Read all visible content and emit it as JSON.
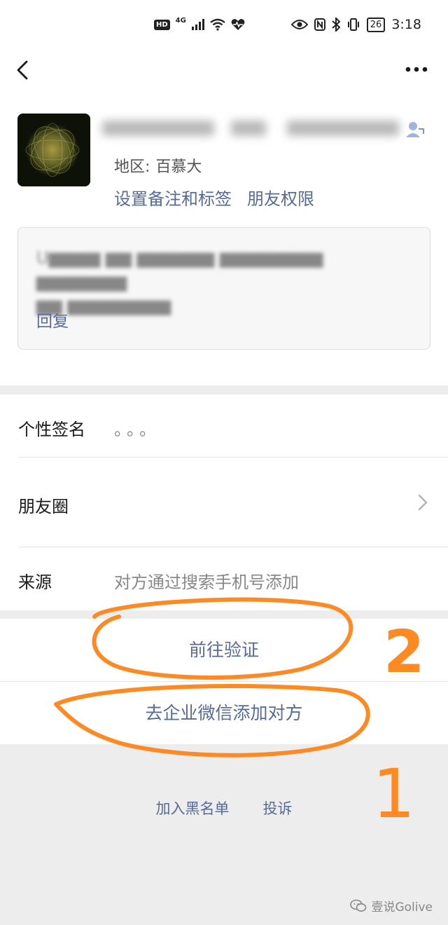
{
  "status_bar": {
    "hd": "HD",
    "network": "4G",
    "battery": "26",
    "time": "3:18"
  },
  "profile": {
    "region_label": "地区:",
    "region_value": "百慕大",
    "set_remark_label": "设置备注和标签",
    "friend_permission_label": "朋友权限"
  },
  "greeting": {
    "reply_label": "回复"
  },
  "info_rows": {
    "signature_label": "个性签名",
    "signature_value": "。。。",
    "moments_label": "朋友圈",
    "source_label": "来源",
    "source_value": "对方通过搜索手机号添加"
  },
  "actions": {
    "verify_label": "前往验证",
    "wecom_add_label": "去企业微信添加对方"
  },
  "footer": {
    "blacklist_label": "加入黑名单",
    "report_label": "投诉"
  },
  "watermark": {
    "text": "壹说Golive"
  },
  "annotations": {
    "mark_2": "2",
    "mark_1": "1",
    "color": "#ff8a24"
  },
  "colors": {
    "link": "#576b95",
    "background": "#ededed"
  },
  "icons": [
    "back-icon",
    "more-icon",
    "contact-tag-icon",
    "chevron-right-icon",
    "wechat-icon"
  ]
}
